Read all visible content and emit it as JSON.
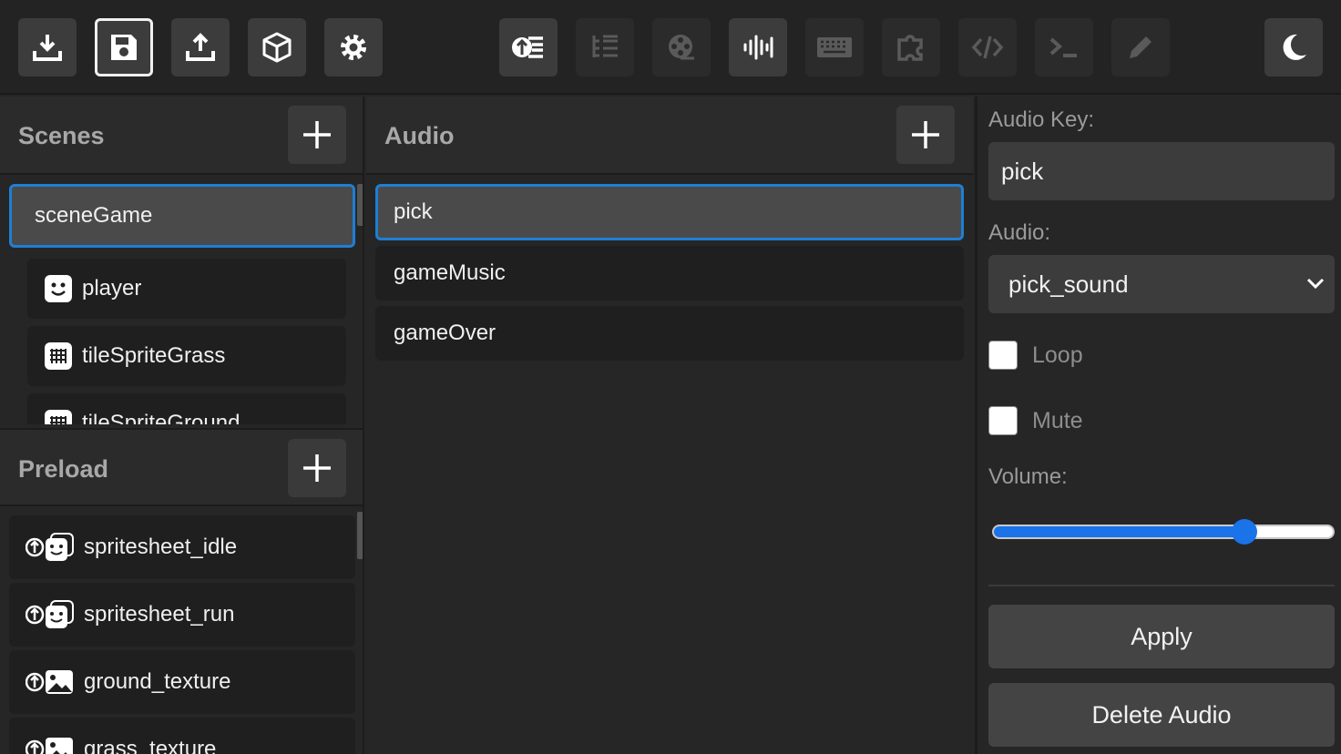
{
  "toolbar": {
    "left_buttons": [
      "download-icon",
      "save-icon",
      "upload-icon",
      "cube-icon",
      "gear-icon"
    ],
    "center_buttons": [
      "upload-preload-icon",
      "list-tree-icon",
      "film-reel-icon",
      "audio-waveform-icon",
      "keyboard-icon",
      "puzzle-icon",
      "code-icon",
      "terminal-icon",
      "pencil-icon"
    ],
    "theme_button": "moon-icon"
  },
  "scenes": {
    "title": "Scenes",
    "items": [
      {
        "label": "sceneGame",
        "selected": true
      },
      {
        "label": "player",
        "icon": "smile-icon"
      },
      {
        "label": "tileSpriteGrass",
        "icon": "grid-icon"
      },
      {
        "label": "tileSpriteGround",
        "icon": "grid-icon"
      }
    ]
  },
  "preload": {
    "title": "Preload",
    "items": [
      {
        "label": "spritesheet_idle",
        "icon": "upload-spritesheet-icon"
      },
      {
        "label": "spritesheet_run",
        "icon": "upload-spritesheet-icon"
      },
      {
        "label": "ground_texture",
        "icon": "upload-image-icon"
      },
      {
        "label": "grass_texture",
        "icon": "upload-image-icon"
      }
    ]
  },
  "audio": {
    "title": "Audio",
    "items": [
      {
        "label": "pick",
        "selected": true
      },
      {
        "label": "gameMusic"
      },
      {
        "label": "gameOver"
      }
    ]
  },
  "inspector": {
    "audio_key_label": "Audio Key:",
    "audio_key_value": "pick",
    "audio_label": "Audio:",
    "audio_selected": "pick_sound",
    "loop_label": "Loop",
    "loop_checked": false,
    "mute_label": "Mute",
    "mute_checked": false,
    "volume_label": "Volume:",
    "volume_value": 0.76,
    "apply_label": "Apply",
    "delete_label": "Delete Audio"
  },
  "colors": {
    "accent": "#1e7fd4",
    "slider": "#1a73e8",
    "background": "#262626",
    "button": "#3c3c3c"
  }
}
